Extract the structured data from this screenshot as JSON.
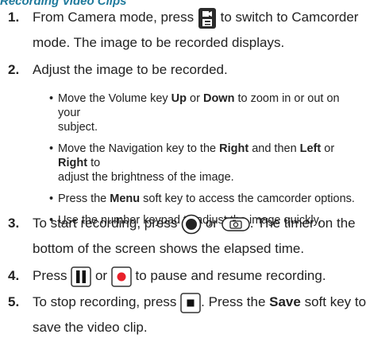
{
  "heading": "Recording Video Clips",
  "steps": [
    {
      "num": "1.",
      "line1_before": "From Camera mode, press",
      "line1_after": "to switch to Camcorder",
      "line2": "mode. The image to be recorded displays."
    },
    {
      "num": "2.",
      "text": "Adjust the image to be recorded.",
      "bullets": [
        {
          "a": "Move the Volume key ",
          "b1": "Up",
          "c": " or ",
          "b2": "Down",
          "d": " to zoom in or out on your",
          "e": "subject."
        },
        {
          "a": "Move the Navigation key to the ",
          "b1": "Right",
          "c": " and then ",
          "b2": "Left",
          "d": " or ",
          "b3": "Right",
          "e": " to",
          "f": "adjust the brightness of the image."
        },
        {
          "a": "Press the ",
          "b1": "Menu",
          "c": " soft key to access the camcorder options."
        },
        {
          "a": "Use the number keypad to adjust the image quickly."
        }
      ]
    },
    {
      "num": "3.",
      "line1_before": "To start recording, press",
      "line1_mid": "or",
      "line1_after": ". The timer on the",
      "line2": "bottom of the screen shows the elapsed time."
    },
    {
      "num": "4.",
      "before": "Press",
      "mid": "or",
      "after": "to pause and resume recording."
    },
    {
      "num": "5.",
      "line1_before": "To stop recording, press",
      "line1_mid": ". Press the ",
      "save": "Save",
      "line1_after": " soft key to",
      "line2": "save the video clip."
    }
  ],
  "colors": {
    "heading": "#1f7a9c",
    "record_red": "#e8202a"
  }
}
